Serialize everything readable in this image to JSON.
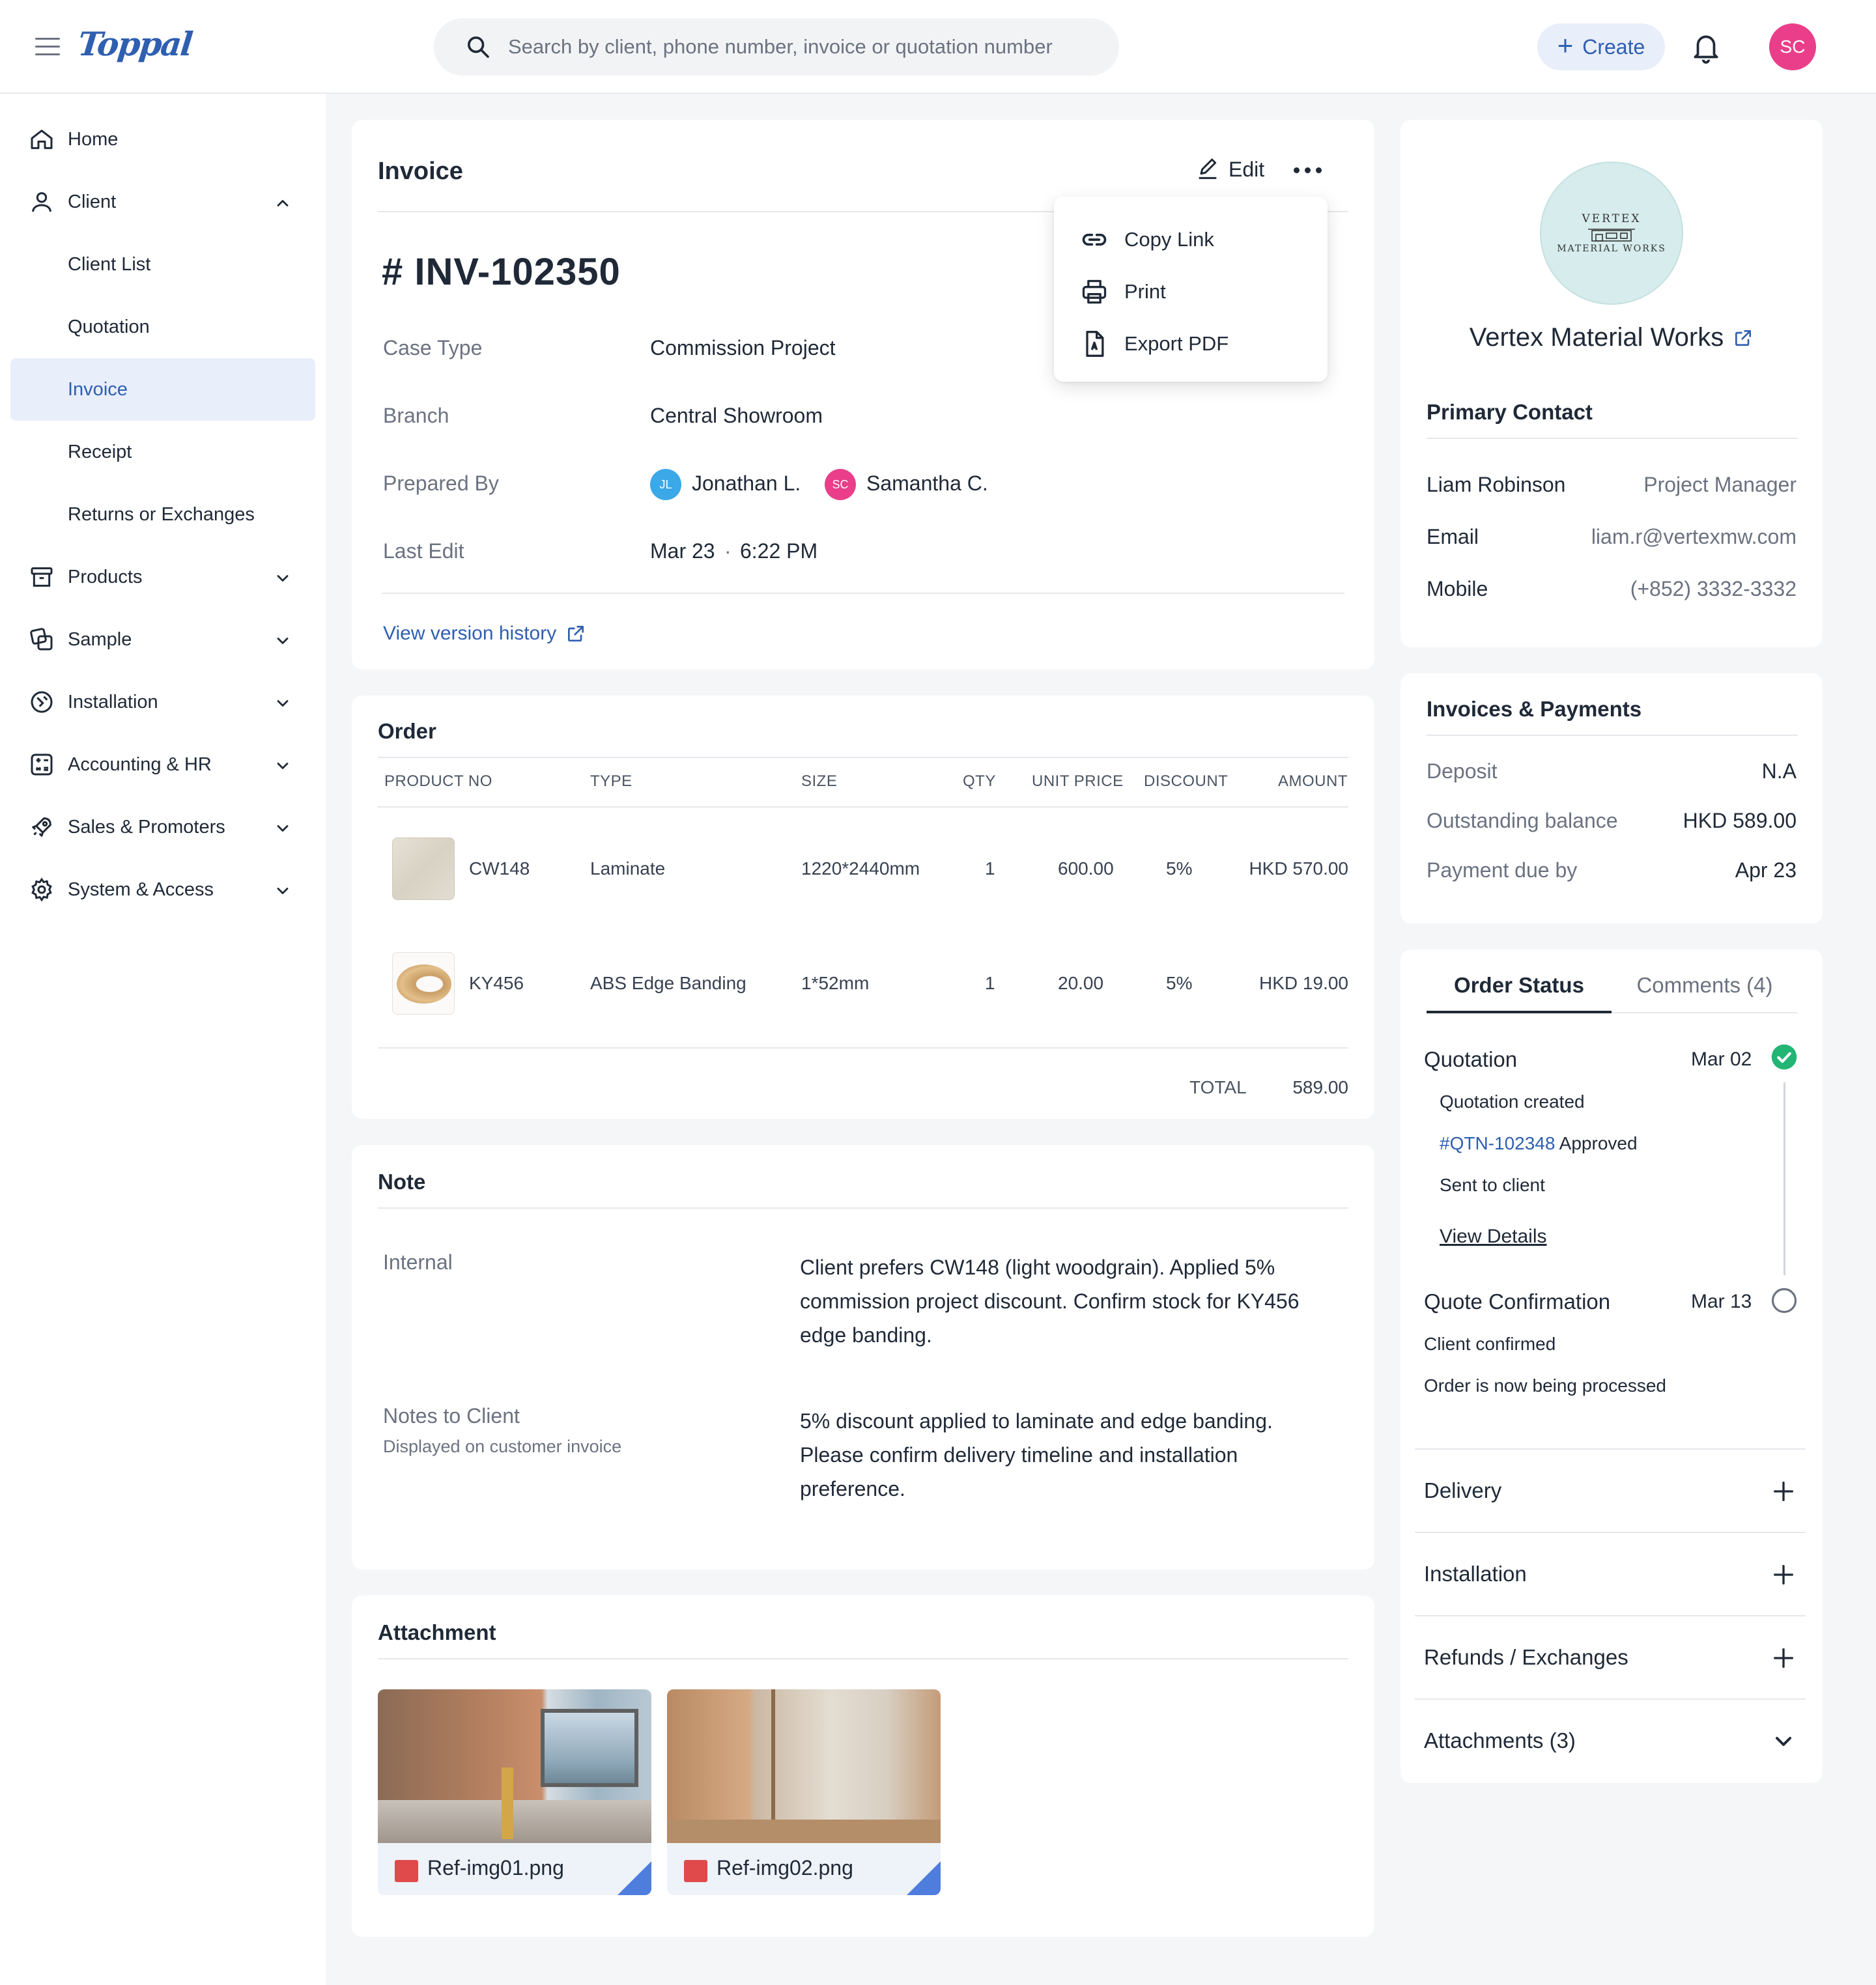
{
  "header": {
    "logo": "Toppal",
    "search_placeholder": "Search by client, phone number, invoice or quotation number",
    "create_label": "Create",
    "user_initials": "SC"
  },
  "sidebar": {
    "items": [
      {
        "label": "Home"
      },
      {
        "label": "Client"
      },
      {
        "label": "Client List"
      },
      {
        "label": "Quotation"
      },
      {
        "label": "Invoice"
      },
      {
        "label": "Receipt"
      },
      {
        "label": "Returns or Exchanges"
      },
      {
        "label": "Products"
      },
      {
        "label": "Sample"
      },
      {
        "label": "Installation"
      },
      {
        "label": "Accounting & HR"
      },
      {
        "label": "Sales & Promoters"
      },
      {
        "label": "System & Access"
      }
    ],
    "active": "Invoice"
  },
  "invoice": {
    "title": "Invoice",
    "edit_label": "Edit",
    "number": "# INV-102350",
    "case_type_label": "Case Type",
    "case_type": "Commission Project",
    "branch_label": "Branch",
    "branch": "Central Showroom",
    "prepared_by_label": "Prepared By",
    "preparers": [
      {
        "initials": "JL",
        "name": "Jonathan L.",
        "color": "#3ba8e8"
      },
      {
        "initials": "SC",
        "name": "Samantha C.",
        "color": "#ea3e8a"
      }
    ],
    "last_edit_label": "Last Edit",
    "last_edit_date": "Mar 23",
    "last_edit_time": "6:22 PM",
    "version_history": "View version history"
  },
  "menu": {
    "items": [
      {
        "label": "Copy Link"
      },
      {
        "label": "Print"
      },
      {
        "label": "Export PDF"
      }
    ]
  },
  "order": {
    "title": "Order",
    "columns": [
      "PRODUCT NO",
      "TYPE",
      "SIZE",
      "QTY",
      "UNIT PRICE",
      "DISCOUNT",
      "AMOUNT"
    ],
    "rows": [
      {
        "product_no": "CW148",
        "type": "Laminate",
        "size": "1220*2440mm",
        "qty": "1",
        "unit_price": "600.00",
        "discount": "5%",
        "amount": "HKD 570.00"
      },
      {
        "product_no": "KY456",
        "type": "ABS Edge Banding",
        "size": "1*52mm",
        "qty": "1",
        "unit_price": "20.00",
        "discount": "5%",
        "amount": "HKD 19.00"
      }
    ],
    "total_label": "TOTAL",
    "total": "589.00"
  },
  "note": {
    "title": "Note",
    "internal_label": "Internal",
    "internal_text": "Client prefers CW148 (light woodgrain). Applied 5% commission project discount. Confirm stock for KY456 edge banding.",
    "client_label": "Notes to Client",
    "client_sublabel": "Displayed on customer invoice",
    "client_text": "5% discount applied to laminate and edge banding. Please confirm delivery timeline and installation preference."
  },
  "attachment": {
    "title": "Attachment",
    "files": [
      {
        "name": "Ref-img01.png"
      },
      {
        "name": "Ref-img02.png"
      }
    ]
  },
  "client": {
    "logo_line1": "VERTEX",
    "logo_line2": "MATERIAL WORKS",
    "name": "Vertex Material Works",
    "primary_contact_title": "Primary Contact",
    "contact_name": "Liam Robinson",
    "contact_role": "Project Manager",
    "email_label": "Email",
    "email": "liam.r@vertexmw.com",
    "mobile_label": "Mobile",
    "mobile": "(+852) 3332-3332"
  },
  "payments": {
    "title": "Invoices & Payments",
    "deposit_label": "Deposit",
    "deposit": "N.A",
    "outstanding_label": "Outstanding balance",
    "outstanding": "HKD 589.00",
    "due_label": "Payment due by",
    "due": "Apr 23"
  },
  "status": {
    "tabs": [
      {
        "label": "Order Status"
      },
      {
        "label": "Comments (4)"
      }
    ],
    "steps": [
      {
        "title": "Quotation",
        "date": "Mar 02",
        "line1": "Quotation created",
        "line2_link": "#QTN-102348",
        "line2_rest": " Approved",
        "line3": "Sent to client",
        "view_details": "View Details"
      },
      {
        "title": "Quote Confirmation",
        "date": "Mar 13",
        "line1": "Client confirmed",
        "line2": "Order is now being processed"
      }
    ],
    "sections": [
      {
        "label": "Delivery"
      },
      {
        "label": "Installation"
      },
      {
        "label": "Refunds / Exchanges"
      },
      {
        "label": "Attachments (3)"
      }
    ],
    "colors": {
      "done": "#22b573",
      "accent": "#2f5fb0"
    }
  }
}
